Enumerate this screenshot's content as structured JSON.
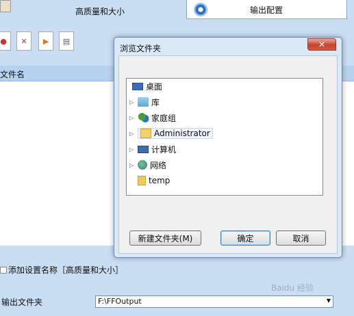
{
  "app": {
    "preset_title": "高质量和大小",
    "config_button": "输出配置",
    "list_header": "文件名",
    "add_preset_name": "添加设置名称［高质量和大小］",
    "output_folder_label": "输出文件夹",
    "output_folder_value": "F:\\FFOutput"
  },
  "dialog": {
    "title": "浏览文件夹",
    "close": "✕",
    "tree": [
      {
        "label": "桌面",
        "icon": "desktop-icon"
      },
      {
        "label": "库",
        "icon": "library-icon"
      },
      {
        "label": "家庭组",
        "icon": "homegroup-icon"
      },
      {
        "label": "Administrator",
        "icon": "user-folder-icon"
      },
      {
        "label": "计算机",
        "icon": "computer-icon"
      },
      {
        "label": "网络",
        "icon": "network-icon"
      },
      {
        "label": "temp",
        "icon": "folder-icon"
      }
    ],
    "new_folder_button": "新建文件夹(M)",
    "ok_button": "确定",
    "cancel_button": "取消"
  },
  "watermark": "Baidu 经验"
}
